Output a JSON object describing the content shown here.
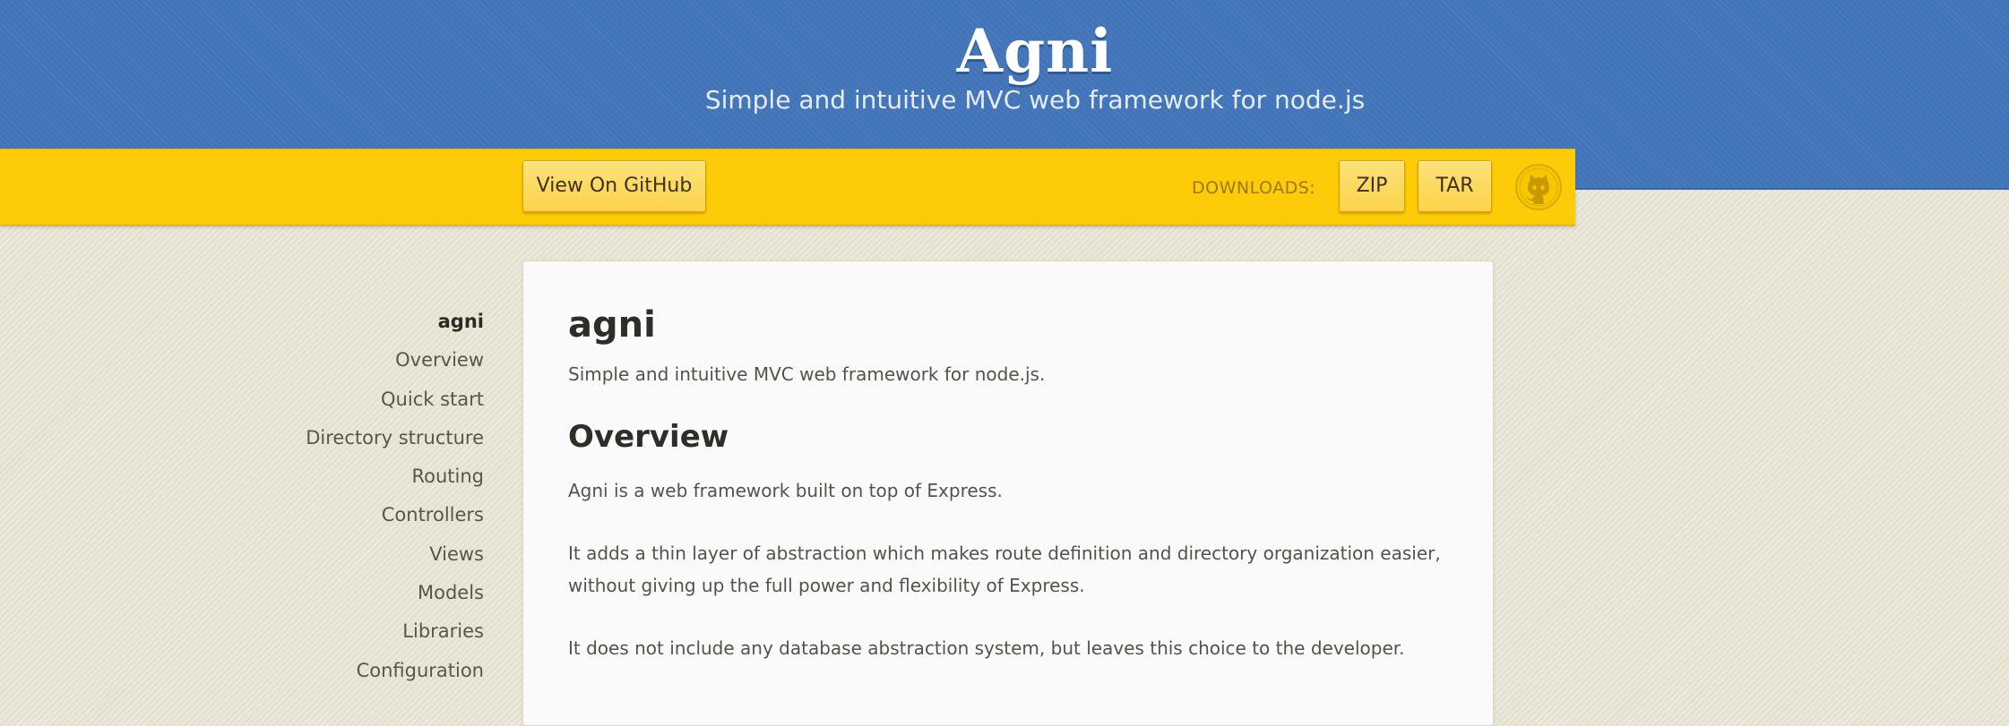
{
  "header": {
    "title": "Agni",
    "subtitle": "Simple and intuitive MVC web framework for node.js"
  },
  "download_bar": {
    "github_label": "View On GitHub",
    "downloads_label": "DOWNLOADS:",
    "zip_label": "ZIP",
    "tar_label": "TAR"
  },
  "sidebar": {
    "items": [
      {
        "label": "agni",
        "active": true
      },
      {
        "label": "Overview"
      },
      {
        "label": "Quick start"
      },
      {
        "label": "Directory structure"
      },
      {
        "label": "Routing"
      },
      {
        "label": "Controllers"
      },
      {
        "label": "Views"
      },
      {
        "label": "Models"
      },
      {
        "label": "Libraries"
      },
      {
        "label": "Configuration"
      }
    ]
  },
  "content": {
    "h1": "agni",
    "tagline": "Simple and intuitive MVC web framework for node.js.",
    "overview_heading": "Overview",
    "paragraphs": [
      "Agni is a web framework built on top of Express.",
      "It adds a thin layer of abstraction which makes route definition and directory organization easier, without giving up the full power and flexibility of Express.",
      "It does not include any database abstraction system, but leaves this choice to the developer."
    ]
  },
  "colors": {
    "header_blue": "#4274b9",
    "bar_yellow": "#fdcb07",
    "page_beige": "#e9e5d4"
  },
  "icons": {
    "github": "octocat-icon"
  }
}
